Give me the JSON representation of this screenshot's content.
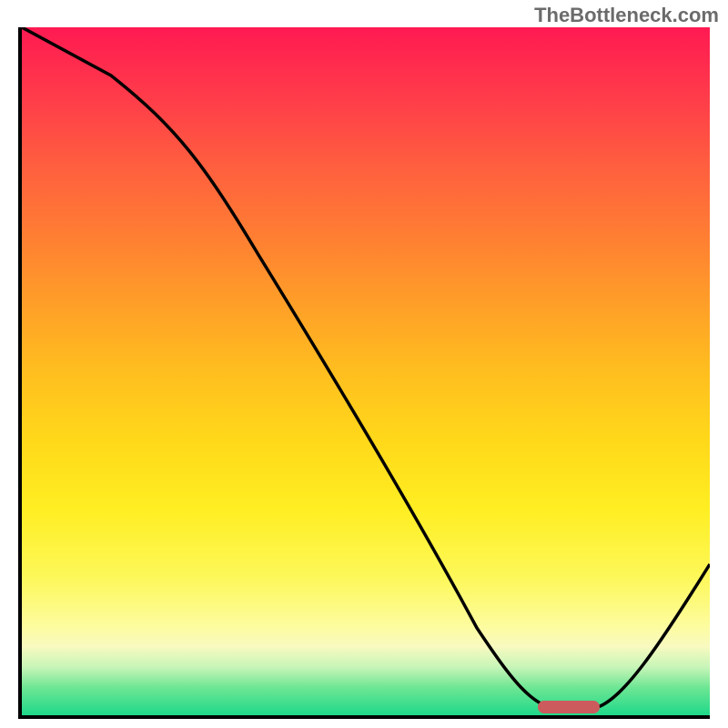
{
  "watermark": "TheBottleneck.com",
  "chart_data": {
    "type": "line",
    "title": "",
    "xlabel": "",
    "ylabel": "",
    "xlim": [
      0,
      100
    ],
    "ylim": [
      0,
      100
    ],
    "grid": false,
    "axes": {
      "left": true,
      "bottom": true,
      "right": false,
      "top": false
    },
    "background_gradient": {
      "direction": "vertical",
      "stops": [
        {
          "pos": 0,
          "color": "#ff1a52"
        },
        {
          "pos": 50,
          "color": "#ffd11a"
        },
        {
          "pos": 90,
          "color": "#fcfaa8"
        },
        {
          "pos": 100,
          "color": "#1ed98a"
        }
      ]
    },
    "series": [
      {
        "name": "bottleneck-curve",
        "color": "#000000",
        "x": [
          0,
          13,
          28,
          45,
          60,
          70,
          75,
          80,
          85,
          92,
          100
        ],
        "values": [
          100,
          93,
          80,
          55,
          30,
          12,
          3,
          1,
          2,
          10,
          22
        ]
      }
    ],
    "marker": {
      "name": "optimal-range",
      "color": "#cc5b5e",
      "x_start": 75,
      "x_end": 84,
      "y": 1
    },
    "description": "Vertical gradient from red (top, high bottleneck) through orange/yellow to green (bottom). Black curve descends from top-left, reaches minimum near x≈78-82, then rises toward right edge. Red rounded marker pill sits at the curve minimum on the green band."
  },
  "colors": {
    "curve": "#000000",
    "marker": "#cc5b5e",
    "axis": "#000000",
    "watermark": "#6b6b6b"
  }
}
